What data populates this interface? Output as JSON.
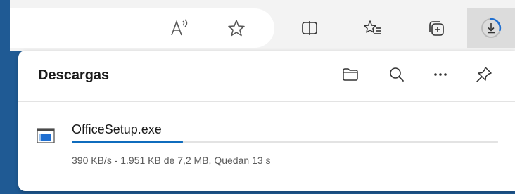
{
  "toolbar": {
    "buttons": [
      {
        "name": "read-aloud-icon"
      },
      {
        "name": "favorite-star-icon"
      },
      {
        "name": "split-screen-icon"
      },
      {
        "name": "favorites-list-icon"
      },
      {
        "name": "collections-icon"
      },
      {
        "name": "downloads-icon"
      }
    ],
    "colors": {
      "active_bg": "#dcdcdc",
      "toolbar_bg": "#f3f3f3",
      "accent": "#1f6fd1"
    }
  },
  "downloads_panel": {
    "title": "Descargas",
    "header_actions": [
      {
        "name": "open-folder-icon"
      },
      {
        "name": "search-icon"
      },
      {
        "name": "more-options-icon"
      },
      {
        "name": "pin-icon"
      }
    ],
    "items": [
      {
        "file_name": "OfficeSetup.exe",
        "file_icon": "executable-file-icon",
        "progress": 0.26,
        "status": "390 KB/s - 1.951 KB de 7,2 MB, Quedan 13 s"
      }
    ]
  },
  "colors": {
    "page_bg": "#1f5a94",
    "progress": "#0f6cbd",
    "track": "#e3e3e3"
  }
}
